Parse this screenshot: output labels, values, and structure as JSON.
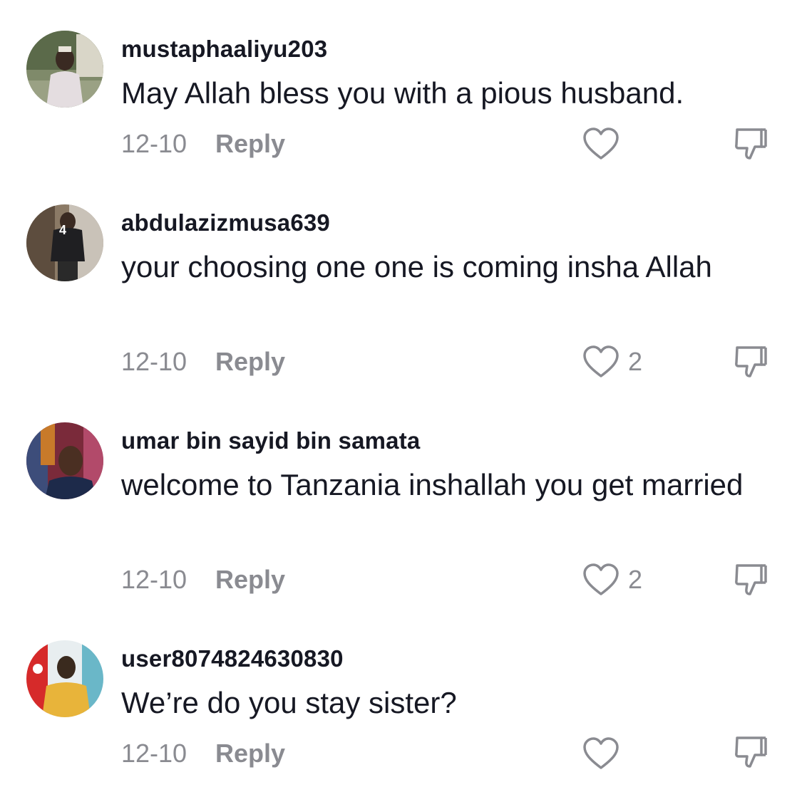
{
  "comments": [
    {
      "username": "mustaphaaliyu203",
      "text": "May Allah bless you with a pious husband.",
      "date": "12-10",
      "reply_label": "Reply",
      "likes": "",
      "avatar_icon": "user-avatar-1"
    },
    {
      "username": "abdulazizmusa639",
      "text": "your choosing one one is coming insha Allah",
      "date": "12-10",
      "reply_label": "Reply",
      "likes": "2",
      "avatar_icon": "user-avatar-2"
    },
    {
      "username": "umar bin sayid bin samata",
      "text": "welcome to Tanzania inshallah you get married",
      "date": "12-10",
      "reply_label": "Reply",
      "likes": "2",
      "avatar_icon": "user-avatar-3"
    },
    {
      "username": "user8074824630830",
      "text": "We’re do you stay sister?",
      "date": "12-10",
      "reply_label": "Reply",
      "likes": "",
      "avatar_icon": "user-avatar-4"
    }
  ],
  "colors": {
    "text": "#161823",
    "muted": "#8a8b91",
    "background": "#ffffff"
  }
}
